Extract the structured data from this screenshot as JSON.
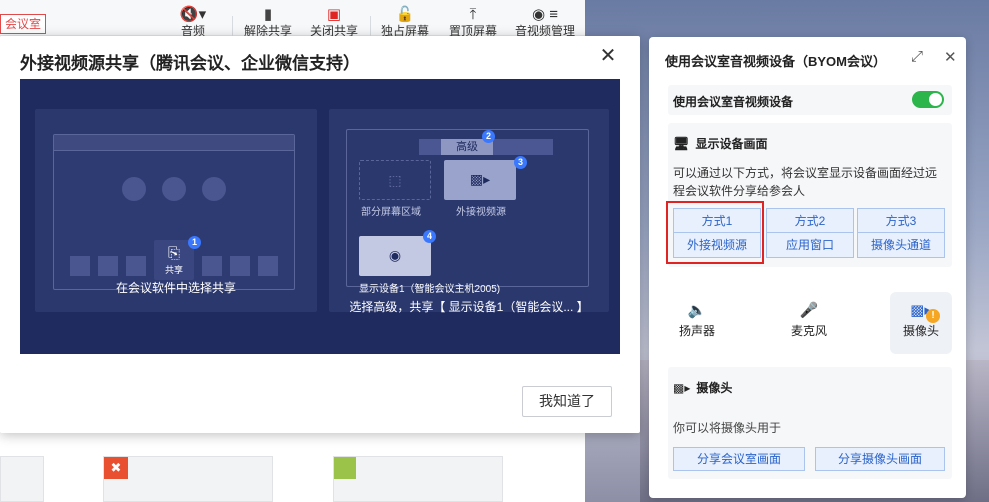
{
  "toolbar": {
    "room_tag": "会议室",
    "items": [
      {
        "icon": "speaker-mute-icon",
        "label": "音频"
      },
      {
        "icon": "screen-share-icon",
        "label": "解除共享"
      },
      {
        "icon": "stop-share-icon",
        "label": "关闭共享"
      },
      {
        "icon": "lock-icon",
        "label": "独占屏幕"
      },
      {
        "icon": "pin-top-icon",
        "label": "置顶屏幕"
      },
      {
        "icon": "camera-icon",
        "label": "音视频管理"
      }
    ]
  },
  "dialog": {
    "title": "外接视频源共享（腾讯会议、企业微信支持）",
    "close_icon": "close-icon",
    "illustration": {
      "left_share_label": "共享",
      "left_caption": "在会议软件中选择共享",
      "right_advanced": "高级",
      "right_partial": "部分屏幕区域",
      "right_external": "外接视频源",
      "right_display": "显示设备1（智能会议主机2005)",
      "right_caption": "选择高级，共享【 显示设备1（智能会议...  】",
      "badges": [
        "1",
        "2",
        "3",
        "4"
      ]
    },
    "confirm_label": "我知道了"
  },
  "byom": {
    "title": "使用会议室音视频设备（BYOM会议）",
    "toggle_label": "使用会议室音视频设备",
    "toggle_on": true,
    "display": {
      "header": "显示设备画面",
      "desc": "可以通过以下方式，将会议室显示设备画面经过远程会议软件分享给参会人",
      "methods": [
        {
          "top": "方式1",
          "bottom": "外接视频源"
        },
        {
          "top": "方式2",
          "bottom": "应用窗口"
        },
        {
          "top": "方式3",
          "bottom": "摄像头通道"
        }
      ]
    },
    "tabs": [
      {
        "icon": "speaker-icon",
        "label": "扬声器"
      },
      {
        "icon": "microphone-icon",
        "label": "麦克风"
      },
      {
        "icon": "camera-icon",
        "label": "摄像头",
        "badge": "!"
      }
    ],
    "camera": {
      "header": "摄像头",
      "desc": "你可以将摄像头用于",
      "btn_room": "分享会议室画面",
      "btn_camera": "分享摄像头画面"
    }
  }
}
